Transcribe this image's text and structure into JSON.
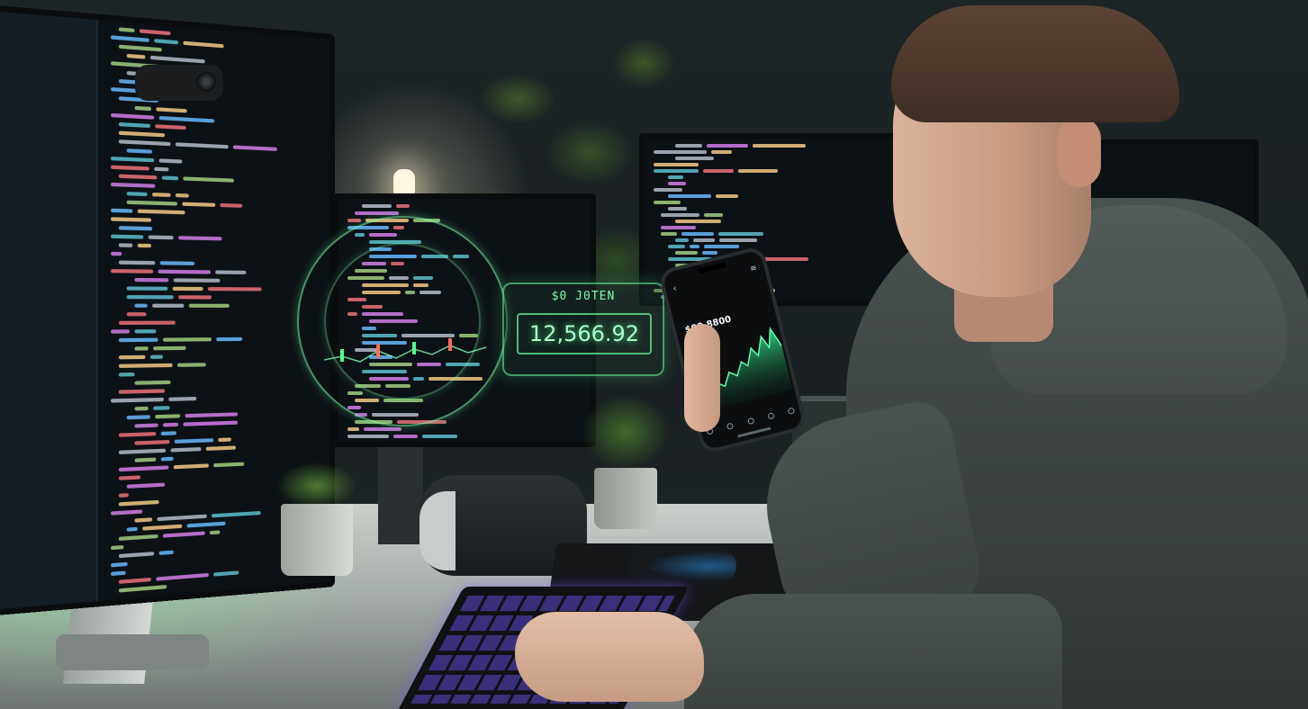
{
  "photo": {
    "holo_panel": {
      "label": "$0 J0TEN",
      "value": "12,566.92"
    },
    "phone_app": {
      "back_glyph": "‹",
      "menu_glyph": "≡",
      "header_text": "",
      "amount": "$00.8800"
    },
    "colors": {
      "holo_green": "#7dffb0",
      "keyboard_glow": "#5a3cff",
      "hoodie": "#454c4a"
    }
  }
}
